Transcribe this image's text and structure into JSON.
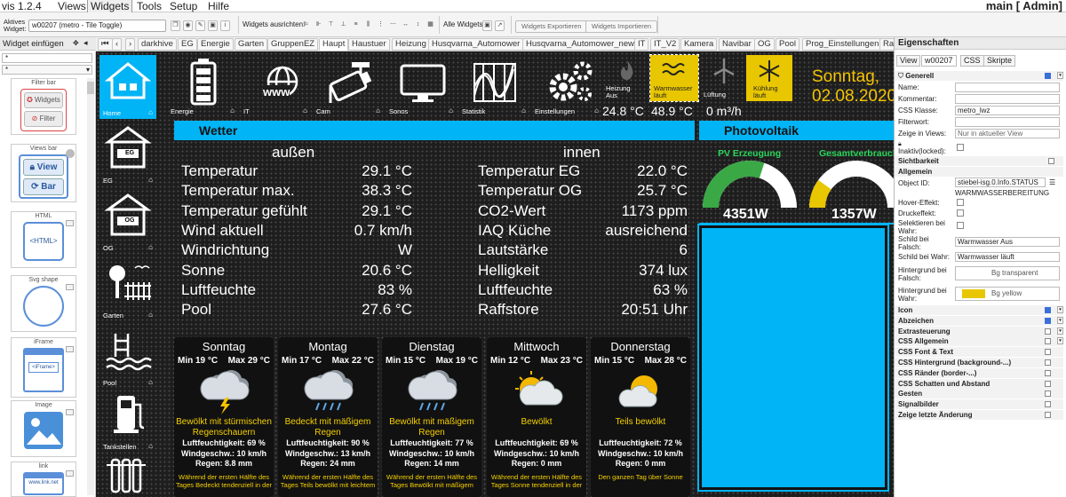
{
  "app": {
    "title": "vis 1.2.4",
    "menu": [
      "Views",
      "Widgets",
      "Tools",
      "Setup",
      "Hilfe"
    ],
    "active_menu": "Widgets",
    "right_title": "main [ Admin]"
  },
  "toolbar": {
    "active_widget_label": "Aktives Widget:",
    "active_widget_value": "w00207 (metro - Tile Toggle)",
    "align_label": "Widgets ausrichten:",
    "all_widgets_label": "Alle Widgets:",
    "export_label": "Widgets Exportieren",
    "import_label": "Widgets Importieren"
  },
  "left_header": "Widget einfügen",
  "palette": {
    "search_placeholder": "*",
    "items": [
      {
        "title": "Filter bar",
        "btn1": "Widgets",
        "btn2": "Filter"
      },
      {
        "title": "Views bar",
        "btn1": "View",
        "btn2": "Bar"
      },
      {
        "title": "HTML",
        "inner": "<HTML>"
      },
      {
        "title": "Svg shape"
      },
      {
        "title": "iFrame",
        "inner": "<iFrame>"
      },
      {
        "title": "Image"
      },
      {
        "title": "link",
        "inner": "www.link.net"
      }
    ]
  },
  "view_tabs": [
    "darkhive",
    "EG",
    "Energie",
    "Garten",
    "GruppenEZ",
    "Haupt",
    "Haustuer",
    "Heizung",
    "Husqvarna_Automower",
    "Husqvarna_Automower_new",
    "IT",
    "IT_V2",
    "Kamera",
    "Navibar",
    "OG",
    "Pool",
    "Prog_Einstellungen",
    "Ra"
  ],
  "active_view": "Haupt",
  "dashboard": {
    "side": [
      {
        "label": "Home"
      },
      {
        "label": "EG",
        "sign": "EG"
      },
      {
        "label": "OG",
        "sign": "OG"
      },
      {
        "label": "Garten"
      },
      {
        "label": "Pool"
      },
      {
        "label": "Tankstellen"
      },
      {
        "label": ""
      }
    ],
    "top": [
      {
        "label": "Energie"
      },
      {
        "label": "IT",
        "sub": "www"
      },
      {
        "label": "Cam"
      },
      {
        "label": "Sonos"
      },
      {
        "label": "Statistik"
      },
      {
        "label": "Einstellungen"
      }
    ],
    "heizung": {
      "label": "Heizung Aus",
      "value": "24.8 °C"
    },
    "warmwasser": {
      "label": "Warmwasser läuft",
      "value": "48.9 °C"
    },
    "lueftung": {
      "label": "Lüftung",
      "value": "0 m³/h"
    },
    "kuehlung": {
      "label": "Kühlung läuft"
    },
    "date": {
      "day": "Sonntag,",
      "date": "02.08.2020"
    },
    "wetter": {
      "title": "Wetter",
      "col1": "außen",
      "col2": "innen",
      "left": [
        {
          "k": "Temperatur",
          "v": "29.1 °C"
        },
        {
          "k": "Temperatur max.",
          "v": "38.3 °C"
        },
        {
          "k": "Temperatur gefühlt",
          "v": "29.1 °C"
        },
        {
          "k": "Wind aktuell",
          "v": "0.7 km/h"
        },
        {
          "k": "Windrichtung",
          "v": "W"
        },
        {
          "k": "Sonne",
          "v": "20.6 °C"
        },
        {
          "k": "Luftfeuchte",
          "v": "83 %"
        },
        {
          "k": "Pool",
          "v": "27.6 °C"
        }
      ],
      "right": [
        {
          "k": "Temperatur EG",
          "v": "22.0 °C"
        },
        {
          "k": "Temperatur OG",
          "v": "25.7 °C"
        },
        {
          "k": "CO2-Wert",
          "v": "1173 ppm"
        },
        {
          "k": "IAQ Küche",
          "v": "ausreichend"
        },
        {
          "k": "Lautstärke",
          "v": "6"
        },
        {
          "k": "Helligkeit",
          "v": "374 lux"
        },
        {
          "k": "Luftfeuchte",
          "v": "63 %"
        },
        {
          "k": "Raffstore",
          "v": "20:51 Uhr"
        }
      ]
    },
    "forecast": [
      {
        "day": "Sonntag",
        "min": "Min 19 °C",
        "max": "Max 29 °C",
        "desc": "Bewölkt mit stürmischen Regenschauern",
        "hum": "Luftfeuchtigkeit: 69 %",
        "wind": "Windgeschw.: 10 km/h",
        "rain": "Regen: 8.8 mm",
        "note": "Während der ersten Hälfte des Tages Bedeckt tendenziell in der",
        "icon": "storm"
      },
      {
        "day": "Montag",
        "min": "Min 17 °C",
        "max": "Max 22 °C",
        "desc": "Bedeckt mit mäßigem Regen",
        "hum": "Luftfeuchtigkeit: 90 %",
        "wind": "Windgeschw.: 13 km/h",
        "rain": "Regen: 24 mm",
        "note": "Während der ersten Hälfte des Tages Teils bewölkt mit leichtem",
        "icon": "rain"
      },
      {
        "day": "Dienstag",
        "min": "Min 15 °C",
        "max": "Max 19 °C",
        "desc": "Bewölkt mit mäßigem Regen",
        "hum": "Luftfeuchtigkeit: 77 %",
        "wind": "Windgeschw.: 10 km/h",
        "rain": "Regen: 14 mm",
        "note": "Während der ersten Hälfte des Tages Bewölkt mit mäßigem",
        "icon": "rain"
      },
      {
        "day": "Mittwoch",
        "min": "Min 12 °C",
        "max": "Max 23 °C",
        "desc": "Bewölkt",
        "hum": "Luftfeuchtigkeit: 69 %",
        "wind": "Windgeschw.: 10 km/h",
        "rain": "Regen: 0 mm",
        "note": "Während der ersten Hälfte des Tages Sonne tendenziell in der",
        "icon": "cloudsun"
      },
      {
        "day": "Donnerstag",
        "min": "Min 15 °C",
        "max": "Max 28 °C",
        "desc": "Teils bewölkt",
        "hum": "Luftfeuchtigkeit: 72 %",
        "wind": "Windgeschw.: 10 km/h",
        "rain": "Regen: 0 mm",
        "note": "Den ganzen Tag über Sonne",
        "icon": "cloudsun"
      }
    ],
    "pv": {
      "title": "Photovoltaik",
      "g1_label": "PV Erzeugung",
      "g1_value": "4351W",
      "g1_fraction": 0.6,
      "g2_label": "Gesamtverbrauch",
      "g2_value": "1357W",
      "g2_fraction": 0.2
    },
    "colors": {
      "accent": "#00b4f5",
      "yellow": "#e8c600",
      "green": "#3aa845"
    }
  },
  "props": {
    "title": "Eigenschaften",
    "tabs": [
      "View",
      "w00207",
      "CSS",
      "Skripte"
    ],
    "active_tab": "w00207",
    "section_generell": "Generell",
    "name_label": "Name:",
    "comment_label": "Kommentar:",
    "cssclass_label": "CSS Klasse:",
    "cssclass_value": "metro_lwz",
    "filter_label": "Filterwort:",
    "views_label": "Zeige in Views:",
    "views_value": "Nur in aktueller View",
    "inaktiv_label": "Inaktiv(locked):",
    "sec_sichtbarkeit": "Sichtbarkeit",
    "sec_allgemein": "Allgemein",
    "objid_label": "Object ID:",
    "objid_value": "stiebel-isg.0.Info.STATUS",
    "objid_sub": "WARMWASSERBEREITUNG",
    "hover_label": "Hover-Effekt:",
    "druck_label": "Druckeffekt:",
    "selekt_label": "Selektieren bei Wahr:",
    "schild_f_label": "Schild bei Falsch:",
    "schild_f_value": "Warmwasser Aus",
    "schild_w_label": "Schild bei Wahr:",
    "schild_w_value": "Warmwasser läuft",
    "bg_f_label": "Hintergrund bei Falsch:",
    "bg_f_value": "Bg transparent",
    "bg_w_label": "Hintergrund bei Wahr:",
    "bg_w_value": "Bg yellow",
    "sections": [
      {
        "label": "Icon",
        "checked": true
      },
      {
        "label": "Abzeichen",
        "checked": true
      },
      {
        "label": "Extrasteuerung",
        "checked": false
      },
      {
        "label": "CSS Allgemein",
        "checked": false
      },
      {
        "label": "CSS Font & Text",
        "checked": false
      },
      {
        "label": "CSS Hintergrund (background-...)",
        "checked": false
      },
      {
        "label": "CSS Ränder (border-...)",
        "checked": false
      },
      {
        "label": "CSS Schatten und Abstand",
        "checked": false
      },
      {
        "label": "Gesten",
        "checked": false
      },
      {
        "label": "Signalbilder",
        "checked": false
      },
      {
        "label": "Zeige letzte Änderung",
        "checked": false
      }
    ]
  }
}
